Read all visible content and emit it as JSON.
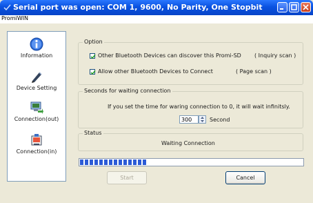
{
  "window": {
    "title": "Serial port was open: COM 1, 9600, No Parity, One Stopbit",
    "menu_label": "PromiWIN"
  },
  "sidebar": {
    "items": [
      {
        "label": "Information",
        "icon": "info-icon"
      },
      {
        "label": "Device Setting",
        "icon": "pen-icon"
      },
      {
        "label": "Connection(out)",
        "icon": "connection-out-icon"
      },
      {
        "label": "Connection(in)",
        "icon": "connection-in-icon"
      }
    ]
  },
  "option": {
    "label": "Option",
    "discover_label": "Other Bluetooth Devices can discover this Promi-SD",
    "discover_hint": "( Inquiry scan )",
    "discover_checked": true,
    "connect_label": "Allow other Bluetooth Devices to Connect",
    "connect_hint": "( Page scan )",
    "connect_checked": true
  },
  "waiting": {
    "label": "Seconds for waiting connection",
    "note": "If you set the time for waring connection to 0, it will wait infinitsly.",
    "seconds_value": "300",
    "unit": "Second"
  },
  "status": {
    "label": "Status",
    "text": "Waiting Connection"
  },
  "progress": {
    "fraction": 0.3
  },
  "buttons": {
    "start_label": "Start",
    "start_enabled": false,
    "cancel_label": "Cancel"
  },
  "colors": {
    "titlebar": "#0a52e0",
    "progress": "#2c5bd6"
  }
}
